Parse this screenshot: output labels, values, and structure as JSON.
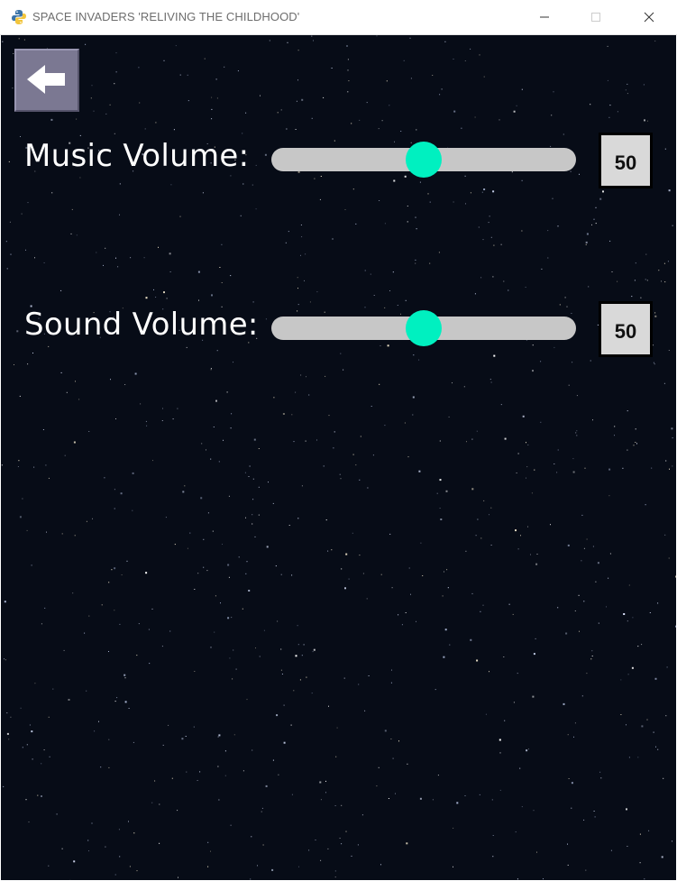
{
  "window": {
    "title": "SPACE INVADERS 'RELIVING THE CHILDHOOD'",
    "icon": "python-icon",
    "controls": {
      "minimize": "minimize-icon",
      "maximize": "maximize-icon",
      "close": "close-icon"
    }
  },
  "colors": {
    "background": "#070c17",
    "slider_track": "#c7c7c7",
    "slider_thumb": "#00f0c0",
    "back_button": "#7b7892",
    "value_box": "#d9d9d9"
  },
  "back_button": {
    "icon": "arrow-left-icon"
  },
  "settings": {
    "music": {
      "label": "Music Volume:",
      "value": 50,
      "value_text": "50",
      "min": 0,
      "max": 100
    },
    "sound": {
      "label": "Sound Volume:",
      "value": 50,
      "value_text": "50",
      "min": 0,
      "max": 100
    }
  }
}
